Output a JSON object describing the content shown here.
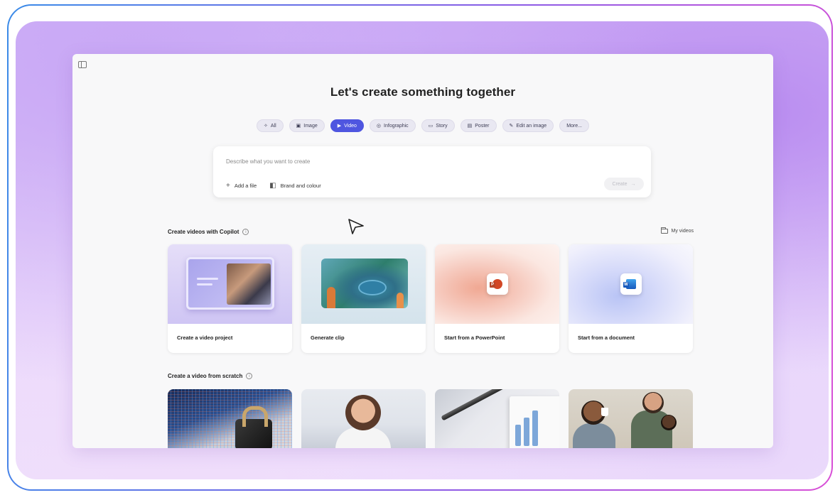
{
  "page": {
    "title": "Let's create something together"
  },
  "filters": [
    {
      "label": "All",
      "icon": "sparkle-icon",
      "active": false
    },
    {
      "label": "Image",
      "icon": "image-icon",
      "active": false
    },
    {
      "label": "Video",
      "icon": "video-icon",
      "active": true
    },
    {
      "label": "Infographic",
      "icon": "infographic-icon",
      "active": false
    },
    {
      "label": "Story",
      "icon": "story-icon",
      "active": false
    },
    {
      "label": "Poster",
      "icon": "poster-icon",
      "active": false
    },
    {
      "label": "Edit an image",
      "icon": "edit-image-icon",
      "active": false
    },
    {
      "label": "More...",
      "icon": "",
      "active": false
    }
  ],
  "prompt": {
    "placeholder": "Describe what you want to create",
    "add_file": "Add a file",
    "brand": "Brand and colour",
    "create": "Create"
  },
  "copilot_section": {
    "title": "Create videos with Copilot",
    "my_videos": "My videos",
    "cards": [
      {
        "label": "Create a video project"
      },
      {
        "label": "Generate clip"
      },
      {
        "label": "Start from a PowerPoint"
      },
      {
        "label": "Start from a document"
      }
    ]
  },
  "scratch_section": {
    "title": "Create a video from scratch"
  },
  "colors": {
    "accent": "#4f56e0",
    "frame_gradient_start": "#3a8be8",
    "frame_gradient_end": "#d94fd6"
  }
}
